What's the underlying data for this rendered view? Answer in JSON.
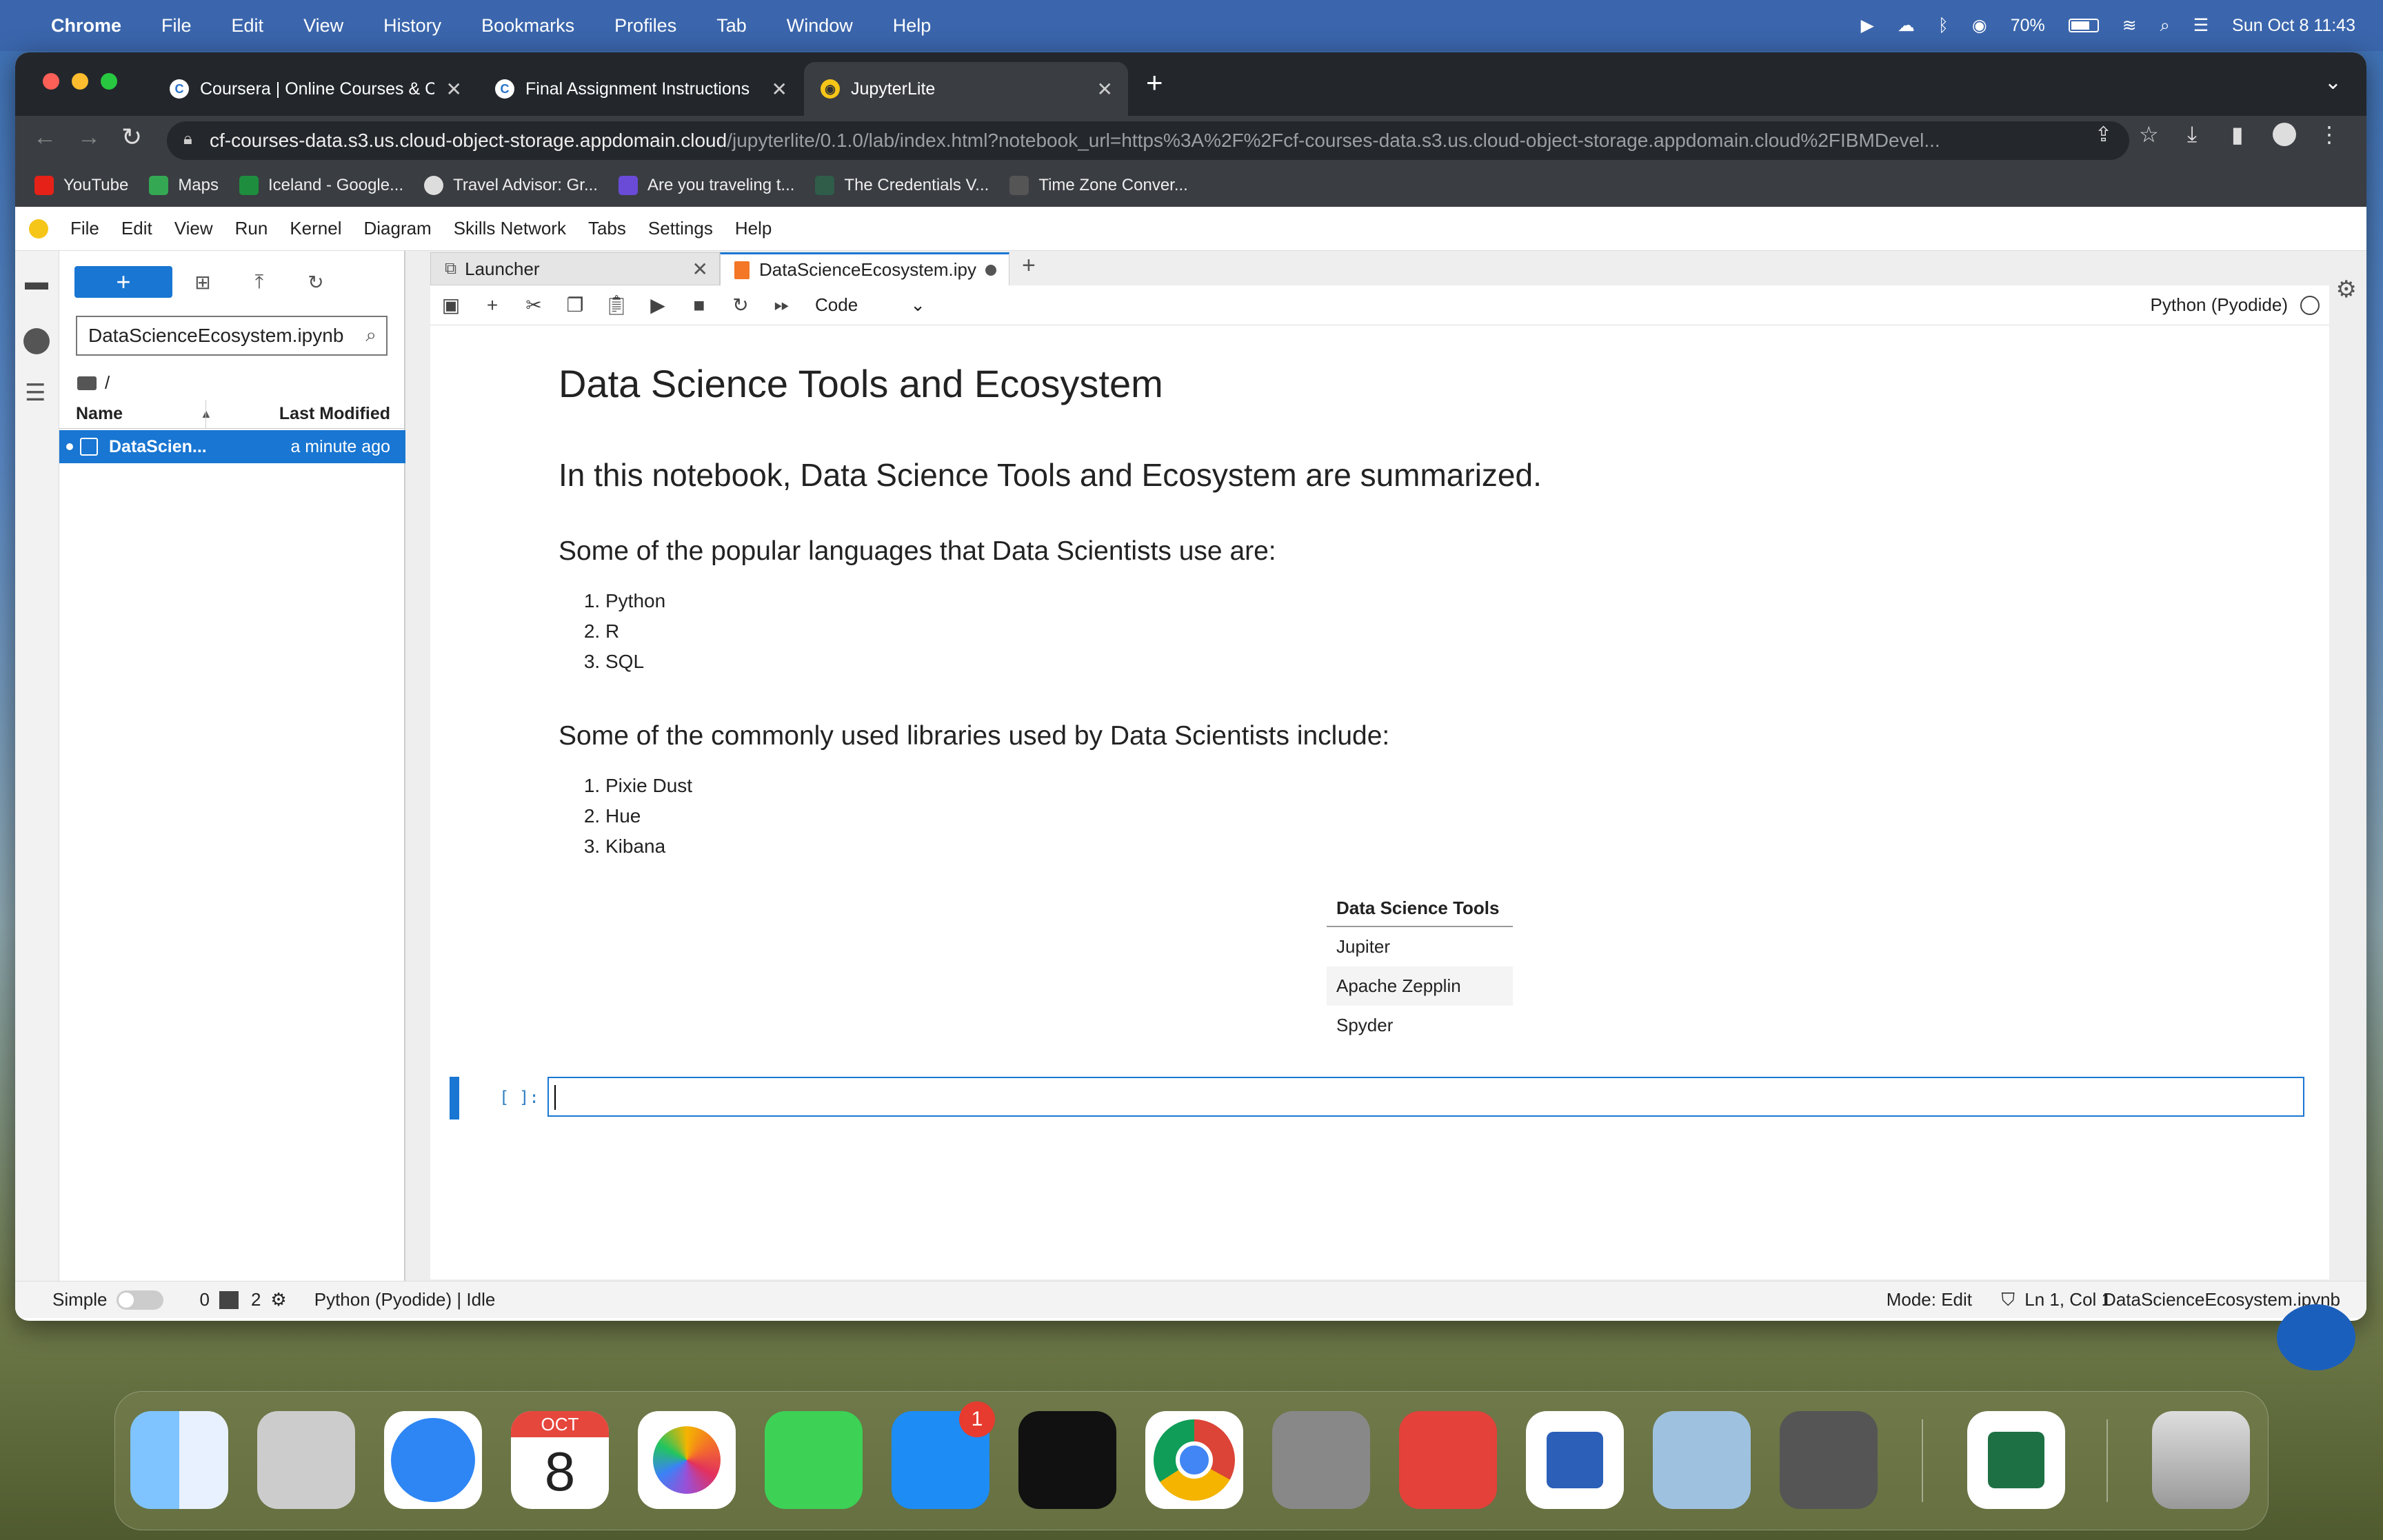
{
  "menubar": {
    "app": "Chrome",
    "items": [
      "File",
      "Edit",
      "View",
      "History",
      "Bookmarks",
      "Profiles",
      "Tab",
      "Window",
      "Help"
    ],
    "battery": "70%",
    "clock": "Sun Oct 8  11:43"
  },
  "browser": {
    "tabs": [
      {
        "title": "Coursera | Online Courses & C"
      },
      {
        "title": "Final Assignment Instructions"
      },
      {
        "title": "JupyterLite"
      }
    ],
    "url_host": "cf-courses-data.s3.us.cloud-object-storage.appdomain.cloud",
    "url_path": "/jupyterlite/0.1.0/lab/index.html?notebook_url=https%3A%2F%2Fcf-courses-data.s3.us.cloud-object-storage.appdomain.cloud%2FIBMDevel...",
    "bookmarks": [
      "YouTube",
      "Maps",
      "Iceland - Google...",
      "Travel Advisor: Gr...",
      "Are you traveling t...",
      "The Credentials V...",
      "Time Zone Conver..."
    ]
  },
  "jupyter": {
    "menu": [
      "File",
      "Edit",
      "View",
      "Run",
      "Kernel",
      "Diagram",
      "Skills Network",
      "Tabs",
      "Settings",
      "Help"
    ],
    "file_search": "DataScienceEcosystem.ipynb",
    "breadcrumb": "/",
    "columns": {
      "name": "Name",
      "modified": "Last Modified"
    },
    "files": [
      {
        "name": "DataScien...",
        "modified": "a minute ago"
      }
    ],
    "doc_tabs": [
      {
        "title": "Launcher"
      },
      {
        "title": "DataScienceEcosystem.ipy"
      }
    ],
    "cell_type": "Code",
    "kernel": "Python (Pyodide)",
    "notebook": {
      "title": "Data Science Tools and Ecosystem",
      "intro": "In this notebook, Data Science Tools and Ecosystem are summarized.",
      "languages_heading": "Some of the popular languages that Data Scientists use are:",
      "languages": [
        "Python",
        "R",
        "SQL"
      ],
      "libraries_heading": "Some of the commonly used libraries used by Data Scientists include:",
      "libraries": [
        "Pixie Dust",
        "Hue",
        "Kibana"
      ],
      "table_header": "Data Science Tools",
      "tools": [
        "Jupiter",
        "Apache Zepplin",
        "Spyder"
      ],
      "prompt": "[ ]:"
    },
    "status": {
      "mode_toggle": "Simple",
      "count_a": "0",
      "count_b": "2",
      "kernel_state": "Python (Pyodide) | Idle",
      "mode": "Mode: Edit",
      "cursor": "Ln 1, Col 1",
      "filename": "DataScienceEcosystem.ipynb"
    }
  },
  "dock": {
    "calendar_month": "OCT",
    "calendar_day": "8",
    "appstore_badge": "1"
  }
}
